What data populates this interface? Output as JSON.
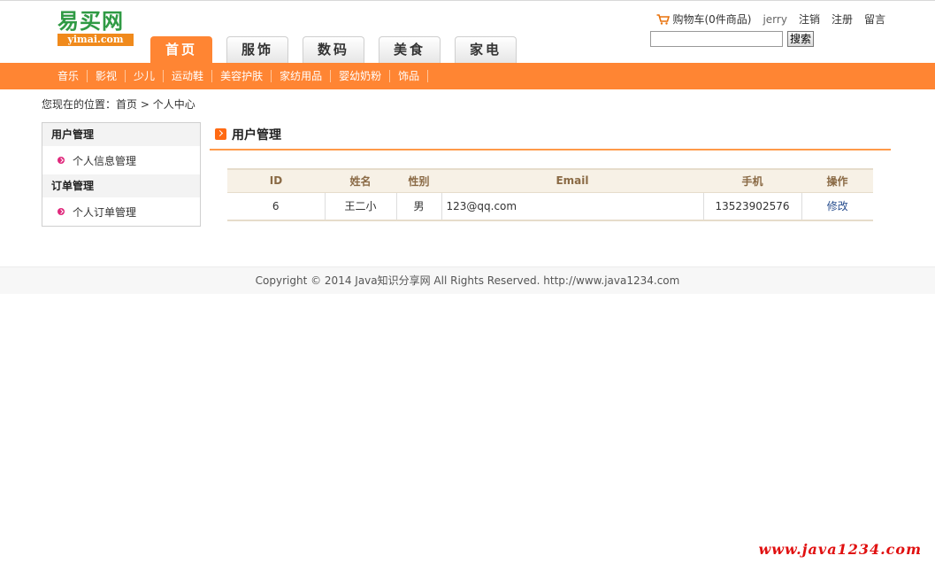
{
  "logo": {
    "cn": "易买网",
    "en": "yimai.com"
  },
  "nav_tabs": [
    "首页",
    "服饰",
    "数码",
    "美食",
    "家电"
  ],
  "user_bar": {
    "cart": "购物车(0件商品)",
    "username": "jerry",
    "logout": "注销",
    "register": "注册",
    "message": "留言"
  },
  "search": {
    "value": "",
    "button": "搜索"
  },
  "categories": [
    "音乐",
    "影视",
    "少儿",
    "运动鞋",
    "美容护肤",
    "家纺用品",
    "婴幼奶粉",
    "饰品"
  ],
  "breadcrumb": {
    "prefix": "您现在的位置：",
    "home": "首页",
    "separator": " > ",
    "current": "个人中心"
  },
  "sidebar": {
    "groups": [
      {
        "title": "用户管理",
        "items": [
          "个人信息管理"
        ]
      },
      {
        "title": "订单管理",
        "items": [
          "个人订单管理"
        ]
      }
    ]
  },
  "main": {
    "title": "用户管理",
    "table": {
      "headers": [
        "ID",
        "姓名",
        "性别",
        "Email",
        "手机",
        "操作"
      ],
      "rows": [
        {
          "id": "6",
          "name": "王二小",
          "gender": "男",
          "email": "123@qq.com",
          "phone": "13523902576",
          "action": "修改"
        }
      ]
    }
  },
  "footer": "Copyright © 2014 Java知识分享网 All Rights Reserved. http://www.java1234.com",
  "watermark": "www.java1234.com",
  "colors": {
    "orange": "#ff8533",
    "logo_green": "#2f9a44",
    "table_header_text": "#8a6a45",
    "link_blue": "#2a4f8f"
  }
}
